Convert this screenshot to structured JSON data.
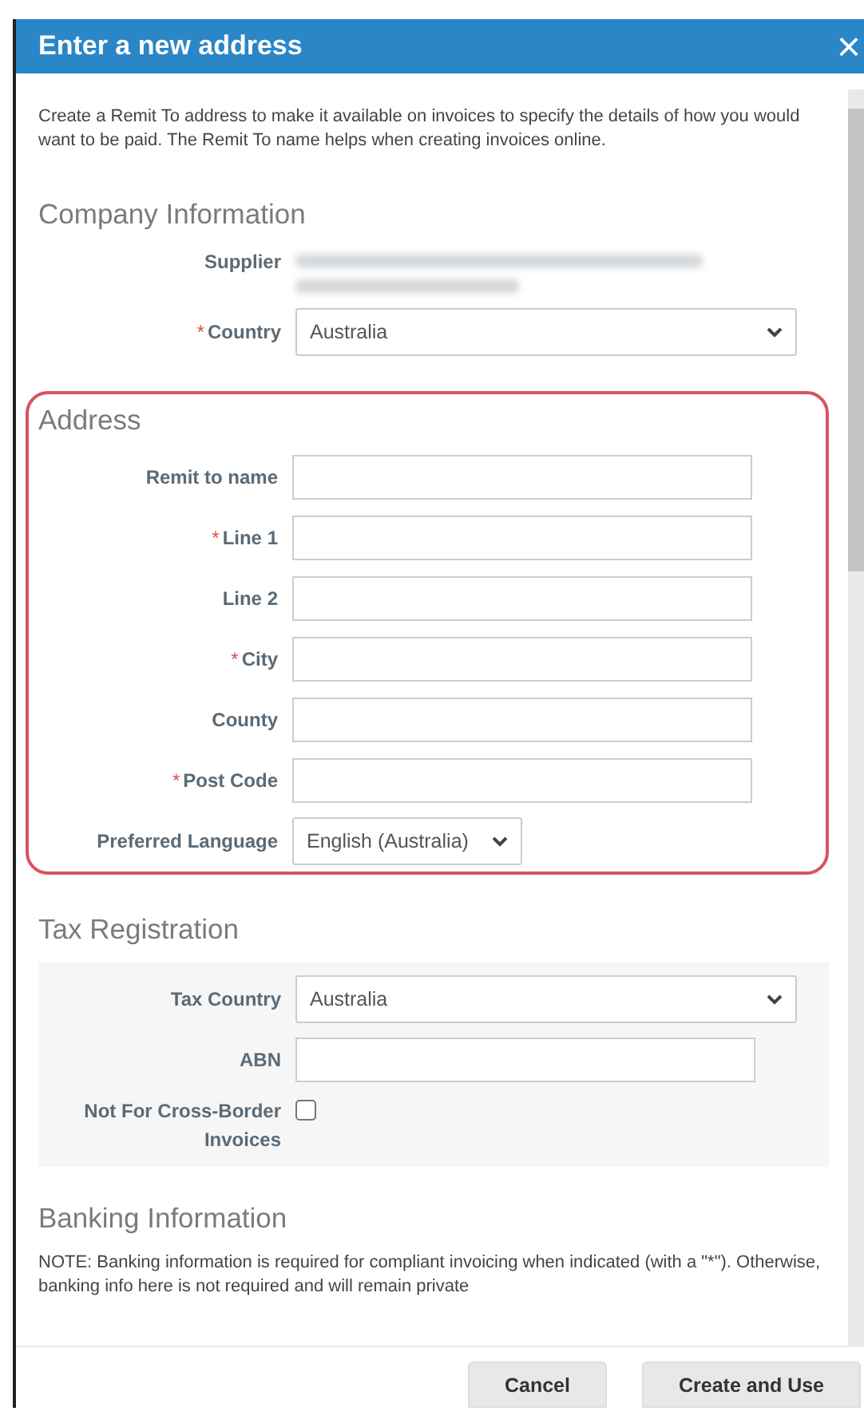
{
  "dialog": {
    "title": "Enter a new address",
    "close": "×"
  },
  "intro": "Create a Remit To address to make it available on invoices to specify the details of how you would want to be paid. The Remit To name helps when creating invoices online.",
  "sections": [
    {
      "heading": "Company Information",
      "fields": [
        {
          "kind": "redacted",
          "label": "Supplier"
        },
        {
          "kind": "select",
          "label": "Country",
          "required_mark": "*",
          "value": "Australia",
          "wide": true
        }
      ]
    },
    {
      "heading": "Address",
      "highlighted": true,
      "fields": [
        {
          "kind": "text",
          "label": "Remit to name"
        },
        {
          "kind": "text",
          "label": "Line 1",
          "required_mark": "*"
        },
        {
          "kind": "text",
          "label": "Line 2"
        },
        {
          "kind": "text",
          "label": "City",
          "required_mark": "*"
        },
        {
          "kind": "text",
          "label": "County"
        },
        {
          "kind": "text",
          "label": "Post Code",
          "required_mark": "*"
        },
        {
          "kind": "select",
          "label": "Preferred Language",
          "value": "English (Australia)",
          "wide": false
        }
      ]
    },
    {
      "heading": "Tax Registration",
      "shaded": true,
      "fields": [
        {
          "kind": "select",
          "label": "Tax Country",
          "value": "Australia",
          "wide": true
        },
        {
          "kind": "text",
          "label": "ABN"
        },
        {
          "kind": "checkbox",
          "label": "Not For Cross-Border Invoices",
          "checked": false
        }
      ]
    },
    {
      "heading": "Banking Information",
      "note": "NOTE: Banking information is required for compliant invoicing when indicated (with a \"*\"). Otherwise, banking info here is not required and will remain private"
    }
  ],
  "buttons": [
    {
      "label": "Cancel"
    },
    {
      "label": "Create and Use"
    }
  ]
}
